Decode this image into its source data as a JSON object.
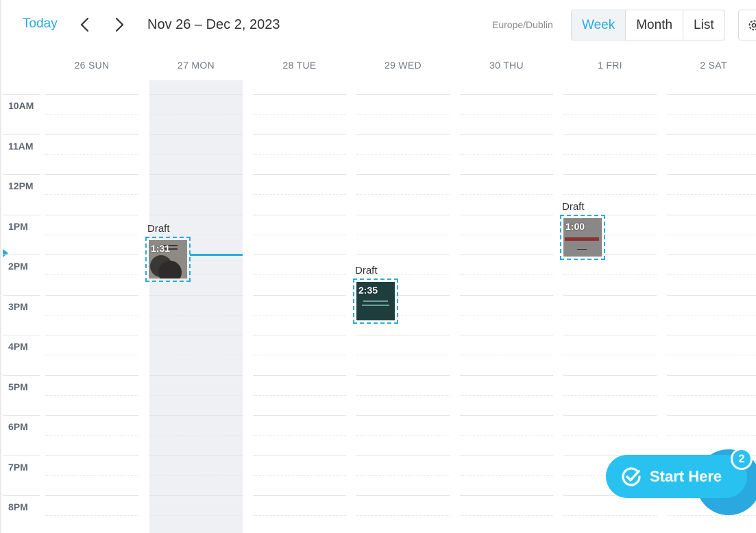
{
  "toolbar": {
    "today_label": "Today",
    "range_title": "Nov 26 – Dec 2, 2023",
    "timezone": "Europe/Dublin",
    "views": [
      "Week",
      "Month",
      "List"
    ],
    "active_view": "Week"
  },
  "days": [
    "26 SUN",
    "27 MON",
    "28 TUE",
    "29 WED",
    "30 THU",
    "1 FRI",
    "2 SAT"
  ],
  "today_column": "27 MON",
  "hours": [
    "10AM",
    "11AM",
    "12PM",
    "1PM",
    "2PM",
    "3PM",
    "4PM",
    "5PM",
    "6PM",
    "7PM",
    "8PM"
  ],
  "events": [
    {
      "day": "27 MON",
      "status": "Draft",
      "duration": "1:31",
      "thumbnail": "dark-circles"
    },
    {
      "day": "29 WED",
      "status": "Draft",
      "duration": "2:35",
      "thumbnail": "dark-teal-text",
      "caption": "PERSONALIZED SUPPORT!"
    },
    {
      "day": "1 FRI",
      "status": "Draft",
      "duration": "1:00",
      "thumbnail": "grey-red-banner"
    }
  ],
  "widget": {
    "label": "Start Here",
    "badge_count": "2",
    "icon": "check-circle-icon"
  },
  "colors": {
    "accent": "#29a9e0",
    "widget": "#29c2f0",
    "today_bg": "#eef0f4"
  }
}
